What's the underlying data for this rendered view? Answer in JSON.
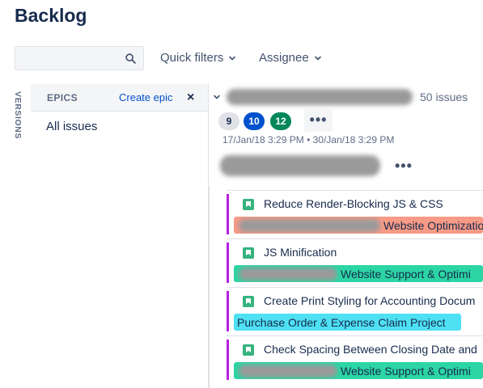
{
  "page": {
    "title": "Backlog"
  },
  "toolbar": {
    "search_placeholder": "",
    "quick_filters_label": "Quick filters",
    "assignee_label": "Assignee"
  },
  "versions_tab": {
    "label": "VERSIONS"
  },
  "epics_panel": {
    "header_label": "EPICS",
    "create_label": "Create epic",
    "close_glyph": "×",
    "all_issues_label": "All issues"
  },
  "sprint": {
    "issue_count": "50 issues",
    "badges": [
      "9",
      "10",
      "12"
    ],
    "more_glyph": "•••",
    "dates": "17/Jan/18 3:29 PM  •  30/Jan/18 3:29 PM",
    "goal_more_glyph": "•••"
  },
  "issues": [
    {
      "summary": "Reduce Render-Blocking JS & CSS",
      "epic": "Website Optimizatio",
      "epic_color": "#f79a86"
    },
    {
      "summary": "JS Minification",
      "epic": "Website Support & Optimi",
      "epic_color": "#2cd5a4"
    },
    {
      "summary": "Create Print Styling for Accounting Docum",
      "epic": "Purchase Order & Expense Claim Project",
      "epic_color": "#4ee0f3"
    },
    {
      "summary": "Check Spacing Between Closing Date and",
      "epic": "Website Support & Optimi",
      "epic_color": "#2cd5a4"
    }
  ],
  "colors": {
    "issue_type_story": "#36b37e",
    "rank_bar": "#b620e0",
    "badge_todo": "#dfe1e6",
    "badge_in_progress": "#0052cc",
    "badge_done": "#00875a",
    "link": "#0052cc"
  },
  "icons": [
    "search-icon",
    "chevron-down-icon",
    "close-icon",
    "more-icon",
    "story-icon"
  ]
}
